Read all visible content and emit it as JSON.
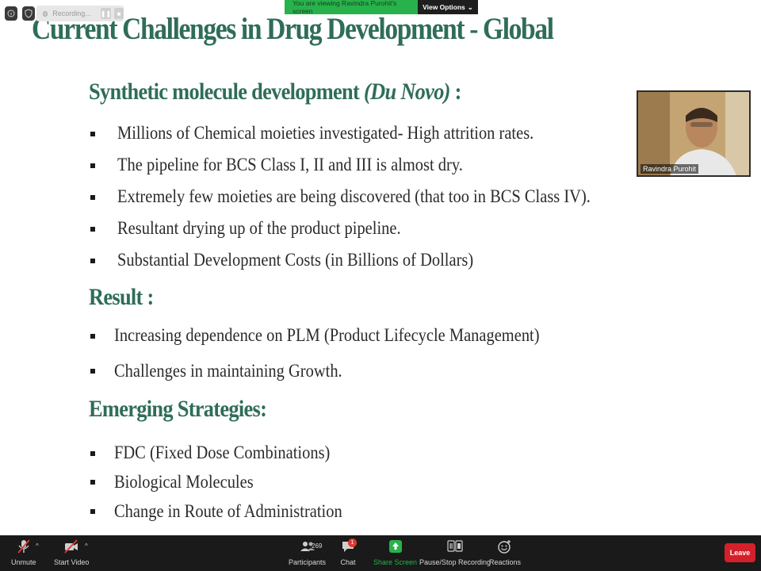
{
  "topbar": {
    "recording_label": "Recording...",
    "viewing_text": "You are viewing Ravindra Purohit's screen",
    "view_options_label": "View Options"
  },
  "slide": {
    "title": "Current Challenges in Drug Development - Global",
    "section1": {
      "heading": "Synthetic molecule development ",
      "heading_italic": "(Du Novo)",
      "heading_suffix": " :"
    },
    "section1_bullets": [
      "Millions of Chemical moieties investigated- High attrition rates.",
      "The pipeline for BCS Class I, II and III is almost dry.",
      "Extremely few moieties are being discovered (that too in BCS Class IV).",
      "Resultant drying up of the product pipeline.",
      "Substantial Development Costs (in Billions of Dollars)"
    ],
    "section2": {
      "heading": "Result :"
    },
    "section2_bullets": [
      "Increasing dependence on PLM (Product Lifecycle Management)",
      "Challenges in maintaining Growth."
    ],
    "section3": {
      "heading": "Emerging Strategies:"
    },
    "section3_bullets": [
      "FDC (Fixed Dose Combinations)",
      "Biological Molecules",
      "Change in Route of Administration"
    ]
  },
  "webcam": {
    "name": "Ravindra Purohit"
  },
  "toolbar": {
    "unmute": "Unmute",
    "start_video": "Start Video",
    "participants": "Participants",
    "participants_count": "269",
    "chat": "Chat",
    "chat_badge": "1",
    "share_screen": "Share Screen",
    "pause_recording": "Pause/Stop Recording",
    "reactions": "Reactions",
    "leave": "Leave"
  },
  "colors": {
    "heading_green": "#2f6d59",
    "toolbar_bg": "#1a1a1a",
    "share_green": "#28b24b",
    "leave_red": "#d4202a"
  }
}
